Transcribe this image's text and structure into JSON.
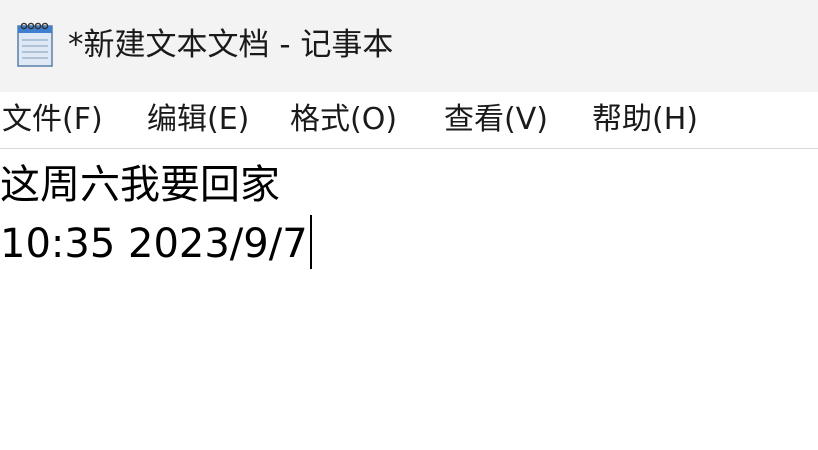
{
  "window": {
    "title": "*新建文本文档 - 记事本",
    "icon": "notepad-icon"
  },
  "menu": {
    "items": [
      {
        "label": "文件(F)"
      },
      {
        "label": "编辑(E)"
      },
      {
        "label": "格式(O)"
      },
      {
        "label": "查看(V)"
      },
      {
        "label": "帮助(H)"
      }
    ]
  },
  "editor": {
    "lines": [
      "这周六我要回家",
      "10:35 2023/9/7"
    ]
  }
}
